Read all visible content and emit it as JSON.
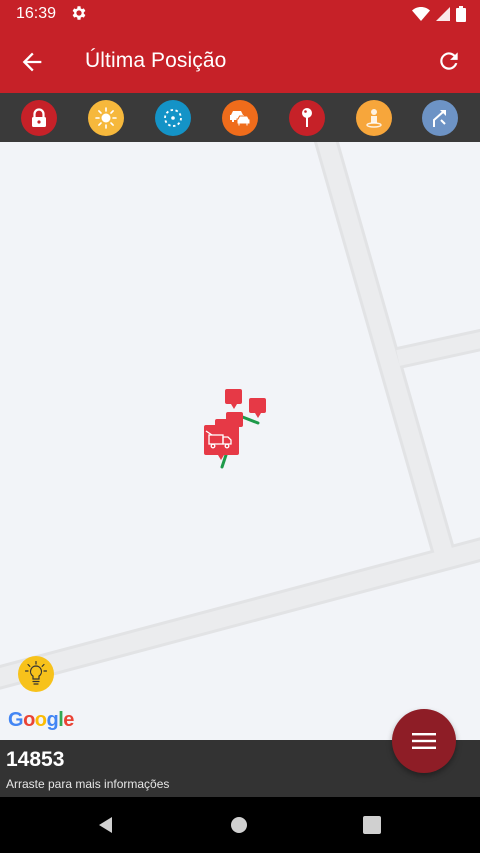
{
  "status_bar": {
    "time": "16:39"
  },
  "app_bar": {
    "title": "Última Posição"
  },
  "toolbar": {
    "buttons": [
      {
        "icon": "lock-icon",
        "color": "#c62128"
      },
      {
        "icon": "sun-icon",
        "color": "#f6b83c"
      },
      {
        "icon": "dashed-circle-icon",
        "color": "#1493c7"
      },
      {
        "icon": "car-traffic-icon",
        "color": "#ef6c1b"
      },
      {
        "icon": "map-pin-icon",
        "color": "#c62128"
      },
      {
        "icon": "person-pin-icon",
        "color": "#f7a63b"
      },
      {
        "icon": "route-arrows-icon",
        "color": "#6d93c5"
      }
    ]
  },
  "map": {
    "attribution": "Google"
  },
  "bottom_sheet": {
    "vehicle_id": "14853",
    "hint": "Arraste para mais informações"
  },
  "colors": {
    "primary": "#c62128",
    "fab": "#8e1d26",
    "marker": "#e63946",
    "route": "#1e9a4a"
  }
}
